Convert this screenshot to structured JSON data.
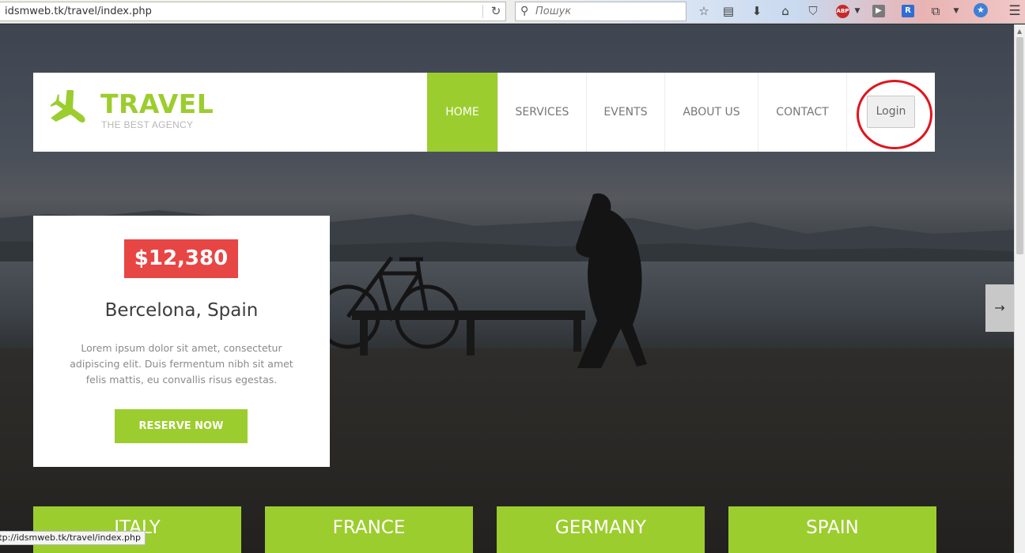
{
  "browser": {
    "url": "idsmweb.tk/travel/index.php",
    "search_placeholder": "Пошук",
    "status_url": "ttp://idsmweb.tk/travel/index.php",
    "icons": [
      "reload-icon",
      "search-icon",
      "bookmark-star-icon",
      "reading-list-icon",
      "download-icon",
      "home-icon",
      "pocket-icon",
      "adblock-icon",
      "video-icon",
      "extension-r-icon",
      "screenshot-icon",
      "menu-icon"
    ],
    "adblock_label": "ABP",
    "r_label": "R"
  },
  "header": {
    "logo_title": "TRAVEL",
    "logo_subtitle": "THE BEST AGENCY",
    "nav": [
      "HOME",
      "SERVICES",
      "EVENTS",
      "ABOUT US",
      "CONTACT"
    ],
    "active_nav": "HOME",
    "login_label": "Login"
  },
  "promo": {
    "price": "$12,380",
    "destination": "Bercelona, Spain",
    "description": "Lorem ipsum dolor sit amet, consectetur adipiscing elit. Duis fermentum nibh sit amet felis mattis, eu convallis risus egestas.",
    "cta_label": "RESERVE NOW"
  },
  "slider": {
    "next_label": "→"
  },
  "countries": [
    "ITALY",
    "FRANCE",
    "GERMANY",
    "SPAIN"
  ],
  "colors": {
    "accent": "#9ccd2e",
    "price_bg": "#e84545",
    "annotation_circle": "#e0141c"
  }
}
